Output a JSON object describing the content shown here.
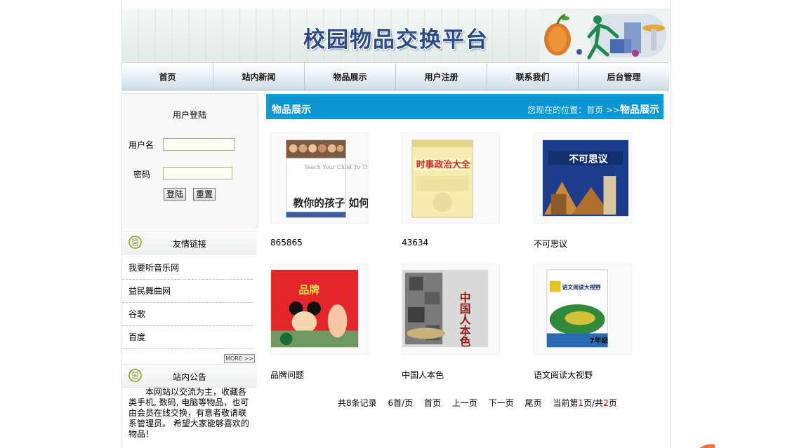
{
  "header": {
    "site_title": "校园物品交换平台"
  },
  "nav": {
    "items": [
      {
        "label": "首页"
      },
      {
        "label": "站内新闻"
      },
      {
        "label": "物品展示"
      },
      {
        "label": "用户注册"
      },
      {
        "label": "联系我们"
      },
      {
        "label": "后台管理"
      }
    ]
  },
  "login": {
    "title": "用户登陆",
    "username_label": "用户名",
    "password_label": "密码",
    "username_value": "",
    "password_value": "",
    "login_button": "登陆",
    "reset_button": "重置"
  },
  "links": {
    "title": "友情链接",
    "items": [
      {
        "label": "我要听音乐网"
      },
      {
        "label": "益民舞曲网"
      },
      {
        "label": "谷歌"
      },
      {
        "label": "百度"
      }
    ],
    "more_label": "MORE >>"
  },
  "notice": {
    "title": "站内公告",
    "text": "本网站以交流为主，收藏各类手机, 数码, 电脑等物品，也可由会员在线交换，有意者敬请联系管理员。      希望大家能够喜欢的物品！"
  },
  "main": {
    "title": "物品展示",
    "breadcrumb_prefix": "您现在的位置：首页 >>",
    "breadcrumb_current": "物品展示",
    "products": [
      {
        "name": "865865",
        "cover_top": "Teach Your Child To Think",
        "cover_cn": "教你的孩子 如何思考"
      },
      {
        "name": "43634",
        "cover_cn": "时事政治大全"
      },
      {
        "name": "不可思议",
        "cover_cn": "不可思议"
      },
      {
        "name": "品牌问题",
        "cover_cn": "品牌"
      },
      {
        "name": "中国人本色",
        "cover_cn": "中国人本色"
      },
      {
        "name": "语文阅读大视野",
        "cover_cn": "语文阅读大视野",
        "cover_grade": "7年级"
      }
    ]
  },
  "pager": {
    "total": "共8条记录",
    "per_page": "6首/页",
    "first": "首页",
    "prev": "上一页",
    "next": "下一页",
    "last": "尾页",
    "current_prefix": "当前第",
    "current_page": "1",
    "current_mid": "页/共",
    "total_pages": "2",
    "current_suffix": "页"
  },
  "colors": {
    "accent_bar": "#0ea0dc",
    "title_blue": "#2b4a87",
    "page_red": "#d40000"
  }
}
